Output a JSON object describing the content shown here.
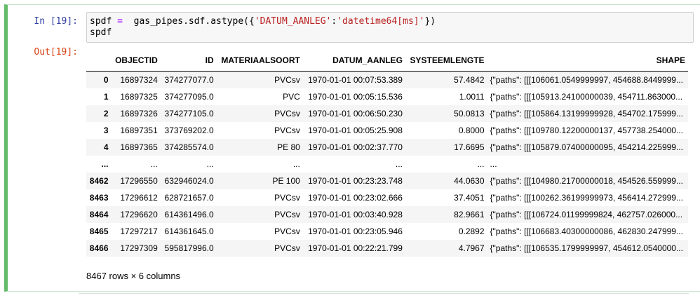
{
  "cell": {
    "in_prompt": "In [19]:",
    "out_prompt": "Out[19]:",
    "code": {
      "line1_var": "spdf",
      "line1_op": "=",
      "line1_call_pre": "gas_pipes.sdf.astype({",
      "line1_key": "'DATUM_AANLEG'",
      "line1_colon": ":",
      "line1_val": "'datetime64[ms]'",
      "line1_call_post": "})",
      "line2": "spdf"
    }
  },
  "table": {
    "columns": [
      "",
      "OBJECTID",
      "ID",
      "MATERIAALSOORT",
      "DATUM_AANLEG",
      "SYSTEEMLENGTE",
      "SHAPE"
    ],
    "rows": [
      [
        "0",
        "16897324",
        "374277077.0",
        "PVCsv",
        "1970-01-01 00:07:53.389",
        "57.4842",
        "{\"paths\": [[[106061.0549999997, 454688.8449999..."
      ],
      [
        "1",
        "16897325",
        "374277095.0",
        "PVC",
        "1970-01-01 00:05:15.536",
        "1.0011",
        "{\"paths\": [[[105913.24100000039, 454711.863000..."
      ],
      [
        "2",
        "16897326",
        "374277105.0",
        "PVCsv",
        "1970-01-01 00:06:50.230",
        "50.0813",
        "{\"paths\": [[[105864.13199999928, 454702.175999..."
      ],
      [
        "3",
        "16897351",
        "373769202.0",
        "PVCsv",
        "1970-01-01 00:05:25.908",
        "0.8000",
        "{\"paths\": [[[109780.12200000137, 457738.254000..."
      ],
      [
        "4",
        "16897365",
        "374285574.0",
        "PE 80",
        "1970-01-01 00:02:37.770",
        "17.6695",
        "{\"paths\": [[[105879.07400000095, 454214.225999..."
      ],
      [
        "...",
        "...",
        "...",
        "...",
        "...",
        "...",
        "..."
      ],
      [
        "8462",
        "17296550",
        "632946024.0",
        "PE 100",
        "1970-01-01 00:23:23.748",
        "44.0630",
        "{\"paths\": [[[104980.21700000018, 454526.559999..."
      ],
      [
        "8463",
        "17296612",
        "628721657.0",
        "PVCsv",
        "1970-01-01 00:23:02.666",
        "37.4051",
        "{\"paths\": [[[100262.36199999973, 456414.272999..."
      ],
      [
        "8464",
        "17296620",
        "614361496.0",
        "PVCsv",
        "1970-01-01 00:03:40.928",
        "82.9661",
        "{\"paths\": [[[106724.01199999824, 462757.026000..."
      ],
      [
        "8465",
        "17297217",
        "614361645.0",
        "PVCsv",
        "1970-01-01 00:23:05.946",
        "0.2892",
        "{\"paths\": [[[106683.40300000086, 462830.247999..."
      ],
      [
        "8466",
        "17297309",
        "595817996.0",
        "PVCsv",
        "1970-01-01 00:22:21.799",
        "4.7967",
        "{\"paths\": [[[106535.1799999997, 454612.0540000..."
      ]
    ],
    "summary": "8467 rows × 6 columns"
  }
}
